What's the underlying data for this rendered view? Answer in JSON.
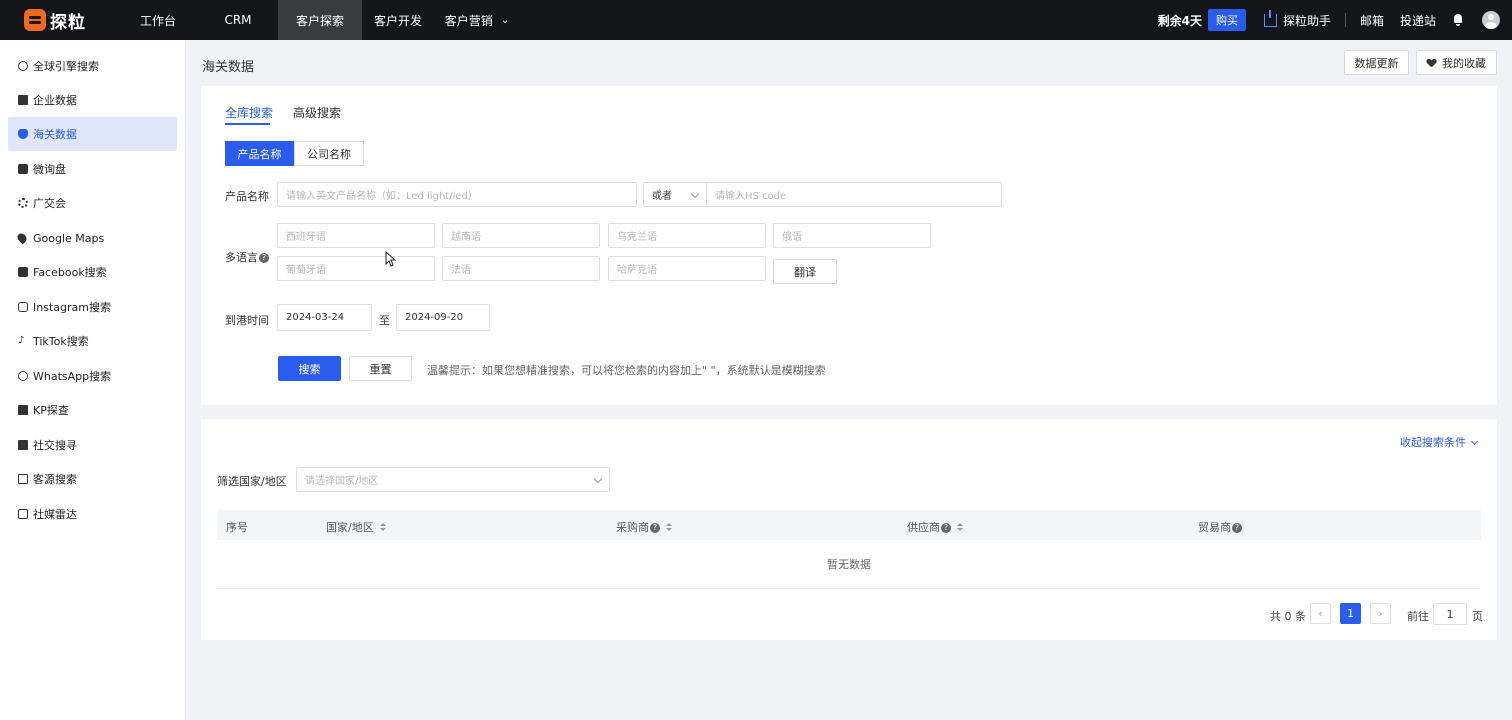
{
  "header": {
    "logo_text": "探粒",
    "nav": [
      "工作台",
      "CRM",
      "客户探索",
      "客户开发",
      "客户营销"
    ],
    "trial_text": "剩余4天",
    "buy_label": "购买",
    "assistant_label": "探粒助手",
    "links": [
      "邮箱",
      "投递站"
    ]
  },
  "sidebar": {
    "items": [
      {
        "label": "全球引擎搜索",
        "icon": "globe-icon"
      },
      {
        "label": "企业数据",
        "icon": "building-icon"
      },
      {
        "label": "海关数据",
        "icon": "ship-icon"
      },
      {
        "label": "微询盘",
        "icon": "chat-icon"
      },
      {
        "label": "广交会",
        "icon": "gear-icon"
      },
      {
        "label": "Google Maps",
        "icon": "map-pin-icon"
      },
      {
        "label": "Facebook搜索",
        "icon": "facebook-icon"
      },
      {
        "label": "Instagram搜索",
        "icon": "instagram-icon"
      },
      {
        "label": "TikTok搜索",
        "icon": "tiktok-icon"
      },
      {
        "label": "WhatsApp搜索",
        "icon": "whatsapp-icon"
      },
      {
        "label": "KP探查",
        "icon": "kp-icon"
      },
      {
        "label": "社交搜寻",
        "icon": "social-icon"
      },
      {
        "label": "客源搜索",
        "icon": "box-icon"
      },
      {
        "label": "社媒雷达",
        "icon": "radar-icon"
      }
    ],
    "active_index": 2
  },
  "page": {
    "title": "海关数据",
    "update_btn": "数据更新",
    "favorites_btn": "我的收藏"
  },
  "search": {
    "tabs": [
      "全库搜索",
      "高级搜索"
    ],
    "segments": [
      "产品名称",
      "公司名称"
    ],
    "product_label": "产品名称",
    "product_placeholder": "请输入英文产品名称（如：Led light/led）",
    "operator_value": "或者",
    "hs_placeholder": "请输入HS code",
    "multilang_label": "多语言",
    "lang_placeholders": [
      "西班牙语",
      "越南语",
      "乌克兰语",
      "俄语",
      "葡萄牙语",
      "法语",
      "哈萨克语"
    ],
    "translate_btn": "翻译",
    "date_label": "到港时间",
    "date_from": "2024-03-24",
    "date_sep": "至",
    "date_to": "2024-09-20",
    "search_btn": "搜索",
    "reset_btn": "重置",
    "tip": "温馨提示：如果您想精准搜索，可以将您检索的内容加上\" \"，系统默认是模糊搜索"
  },
  "results": {
    "collapse_link": "收起搜索条件",
    "filter_label": "筛选国家/地区",
    "filter_placeholder": "请选择国家/地区",
    "columns": [
      "序号",
      "国家/地区",
      "采购商",
      "供应商",
      "贸易商"
    ],
    "empty_text": "暂无数据",
    "pagination": {
      "total_text": "共 0 条",
      "current_page": "1",
      "goto_label": "前往",
      "goto_value": "1",
      "page_suffix": "页"
    }
  },
  "colors": {
    "accent": "#2a5cf0",
    "topbar_bg": "#15161a",
    "logo": "#f26a1b"
  }
}
